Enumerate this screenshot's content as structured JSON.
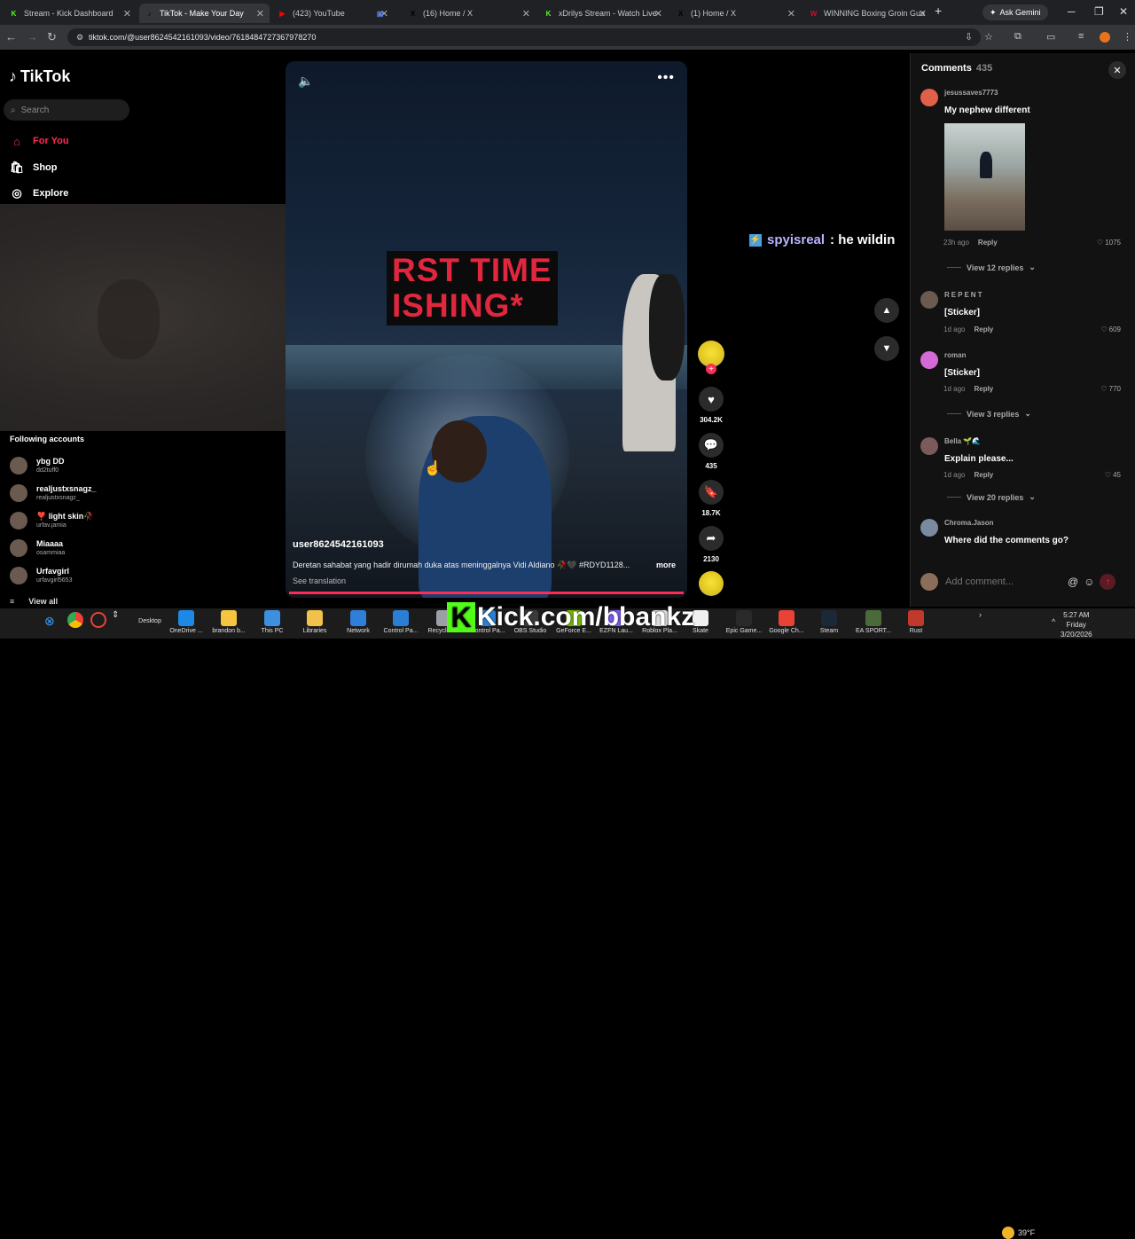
{
  "browser": {
    "tabs": [
      {
        "title": "Stream - Kick Dashboard",
        "fav": "K",
        "fav_color": "#53fc18"
      },
      {
        "title": "TikTok - Make Your Day",
        "fav": "♪",
        "fav_color": "#000000",
        "active": true
      },
      {
        "title": "(423) YouTube",
        "fav": "▶",
        "fav_color": "#ff0000"
      },
      {
        "title": "",
        "fav": "▣",
        "fav_color": "#5b7bd5"
      },
      {
        "title": "(16) Home / X",
        "fav": "X",
        "fav_color": "#000000"
      },
      {
        "title": "xDrilys Stream - Watch Live",
        "fav": "K",
        "fav_color": "#53fc18"
      },
      {
        "title": "(1) Home / X",
        "fav": "X",
        "fav_color": "#000000"
      },
      {
        "title": "WINNING Boxing Groin Gua",
        "fav": "W",
        "fav_color": "#c0152f"
      }
    ],
    "ask_gemini": "Ask Gemini",
    "url": "tiktok.com/@user8624542161093/video/7618484727367978270"
  },
  "sidebar": {
    "logo_text": "TikTok",
    "search_placeholder": "Search",
    "nav": [
      {
        "label": "For You",
        "icon": "home-icon",
        "color": "#fe2c55"
      },
      {
        "label": "Shop",
        "icon": "shop-icon",
        "color": "#ffffff"
      },
      {
        "label": "Explore",
        "icon": "compass-icon",
        "color": "#ffffff"
      }
    ],
    "following_title": "Following accounts",
    "following": [
      {
        "name": "ybg DD",
        "handle": "dd2tuff0"
      },
      {
        "name": "realjustxsnagz_",
        "handle": "realjustxsnagz_"
      },
      {
        "name": "❣️ light skin🥀",
        "handle": "urfav.jamia"
      },
      {
        "name": "Miaaaa",
        "handle": "osammiaa"
      },
      {
        "name": "Urfavgirl",
        "handle": "urfavgirl5653"
      }
    ],
    "view_all": "View all"
  },
  "video": {
    "caption_line1": "RST TIME",
    "caption_line2": "ISHING*",
    "username": "user8624542161093",
    "description": "Deretan sahabat yang hadir dirumah duka atas meninggalnya Vidi Aldiano 🥀🖤 #RDYD1128...",
    "more": "more",
    "see_translation": "See translation",
    "progress": 1.0
  },
  "actions": {
    "likes": "304.2K",
    "comments": "435",
    "saves": "18.7K",
    "shares": "2130"
  },
  "chat_overlay": {
    "user": "spyisreal",
    "message": ": he wildin"
  },
  "comments_panel": {
    "title": "Comments",
    "count": "435",
    "comments": [
      {
        "user": "jesussaves7773",
        "text": "My nephew different",
        "age": "23h ago",
        "reply": "Reply",
        "likes": "1075",
        "avatar_color": "#e0604a",
        "replies": "View 12 replies"
      },
      {
        "user": "REPENT",
        "text": "[Sticker]",
        "age": "1d ago",
        "reply": "Reply",
        "likes": "609",
        "avatar_color": "#6a5a50"
      },
      {
        "user": "roman",
        "text": "[Sticker]",
        "age": "1d ago",
        "reply": "Reply",
        "likes": "770",
        "avatar_color": "#d46ad6",
        "replies": "View 3 replies"
      },
      {
        "user": "Bella 🌱🌊",
        "text": "Explain please...",
        "age": "1d ago",
        "reply": "Reply",
        "likes": "45",
        "avatar_color": "#7a5a5a",
        "replies": "View 20 replies"
      },
      {
        "user": "Chroma.Jason",
        "text": "Where did the comments go?",
        "avatar_color": "#7a8aa0"
      }
    ],
    "add_placeholder": "Add comment..."
  },
  "taskbar": {
    "items": [
      {
        "label": "Desktop",
        "color": "#1c1c1c"
      },
      {
        "label": "OneDrive ...",
        "color": "#1e88e5"
      },
      {
        "label": "brandon b...",
        "color": "#f5c542"
      },
      {
        "label": "This PC",
        "color": "#3d8fe0"
      },
      {
        "label": "Libraries",
        "color": "#f0c24b"
      },
      {
        "label": "Network",
        "color": "#2f7fd8"
      },
      {
        "label": "Control Pa...",
        "color": "#2a7fd4"
      },
      {
        "label": "Recycle Bin",
        "color": "#9aa0a6"
      },
      {
        "label": "Control Pa...",
        "color": "#2a7fd4"
      },
      {
        "label": "OBS Studio",
        "color": "#3a3a3a"
      },
      {
        "label": "GeForce E...",
        "color": "#76b900"
      },
      {
        "label": "EZFN Lau...",
        "color": "#7f5af0"
      },
      {
        "label": "Roblox Pla...",
        "color": "#e0e0e0"
      },
      {
        "label": "Skate",
        "color": "#f0f0f0"
      },
      {
        "label": "Epic Game...",
        "color": "#2a2a2a"
      },
      {
        "label": "Google Ch...",
        "color": "#ea4335"
      },
      {
        "label": "Steam",
        "color": "#1b2838"
      },
      {
        "label": "EA SPORT...",
        "color": "#4a6a3a"
      },
      {
        "label": "Rust",
        "color": "#c0392b"
      }
    ],
    "kick_banner": "Kick.com/bbankz",
    "weather_temp": "39°F",
    "time": "5:27 AM",
    "day": "Friday",
    "date": "3/20/2026"
  }
}
